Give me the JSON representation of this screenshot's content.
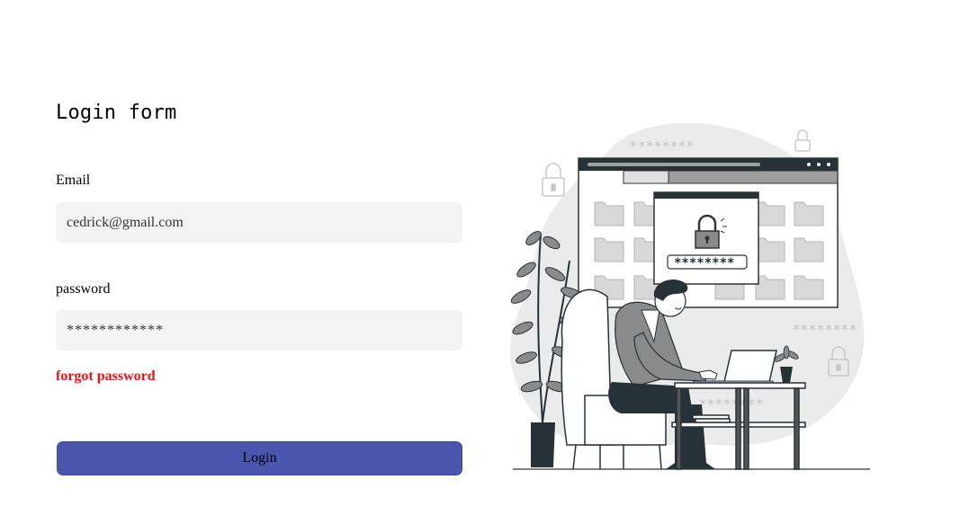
{
  "form": {
    "title": "Login form",
    "email_label": "Email",
    "email_value": "cedrick@gmail.com",
    "password_label": "password",
    "password_value": "************",
    "forgot_label": "forgot password",
    "login_label": "Login"
  },
  "illustration": {
    "password_mask": "********",
    "floating_mask": "********"
  },
  "colors": {
    "accent": "#4a56ad",
    "forgot": "#e51414",
    "field_bg": "#f3f3f3"
  }
}
